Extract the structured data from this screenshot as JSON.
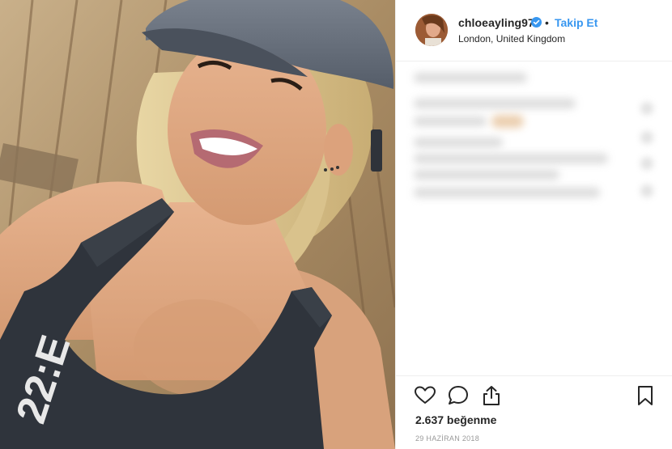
{
  "header": {
    "username": "chloeayling97",
    "separator": "•",
    "follow_label": "Takip Et",
    "location": "London, United Kingdom"
  },
  "footer": {
    "likes": "2.637 beğenme",
    "date": "29 HAZİRAN 2018"
  },
  "icons": {
    "like": "heart-outline",
    "comment": "speech-bubble",
    "share": "share-arrow",
    "save": "bookmark"
  },
  "photo": {
    "shirt_text": "22:E"
  },
  "colors": {
    "accent": "#3897f0",
    "verified": "#3897f0",
    "text": "#262626",
    "muted": "#999999",
    "divider": "#efefef"
  }
}
